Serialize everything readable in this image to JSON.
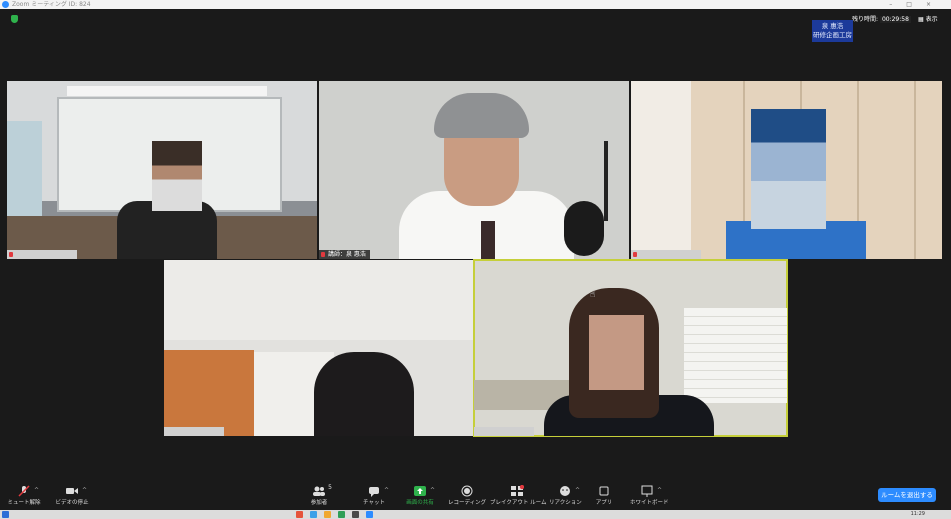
{
  "window": {
    "title": "Zoom ミーティング ID: 824"
  },
  "header": {
    "time_remaining_label": "残り時間:",
    "time_remaining_value": "00:29:58",
    "view_label": "表示",
    "org_label_line1": "泉 惠浩",
    "org_label_line2": "研修企画工房"
  },
  "participants": [
    {
      "name": "",
      "muted": true
    },
    {
      "name": "講師：泉 惠浩",
      "muted": true
    },
    {
      "name": "",
      "muted": true
    },
    {
      "name": "",
      "muted": false
    },
    {
      "name": "",
      "muted": false,
      "active_speaker": true
    }
  ],
  "toolbar": {
    "unmute_label": "ミュート解除",
    "stop_video_label": "ビデオの停止",
    "participants_label": "参加者",
    "participants_count": "5",
    "chat_label": "チャット",
    "share_label": "画面の共有",
    "record_label": "レコーディング",
    "breakout_label": "ブレイクアウト ルーム",
    "reactions_label": "リアクション",
    "apps_label": "アプリ",
    "whiteboard_label": "ホワイトボード",
    "leave_label": "ルームを退出する"
  },
  "taskbar": {
    "clock": "11:29"
  },
  "colors": {
    "accent": "#2d8cff",
    "share_green": "#2fb24c",
    "active_outline": "#c5cf3a",
    "org_badge": "#1c3a9a",
    "muted_red": "#e0393e"
  }
}
